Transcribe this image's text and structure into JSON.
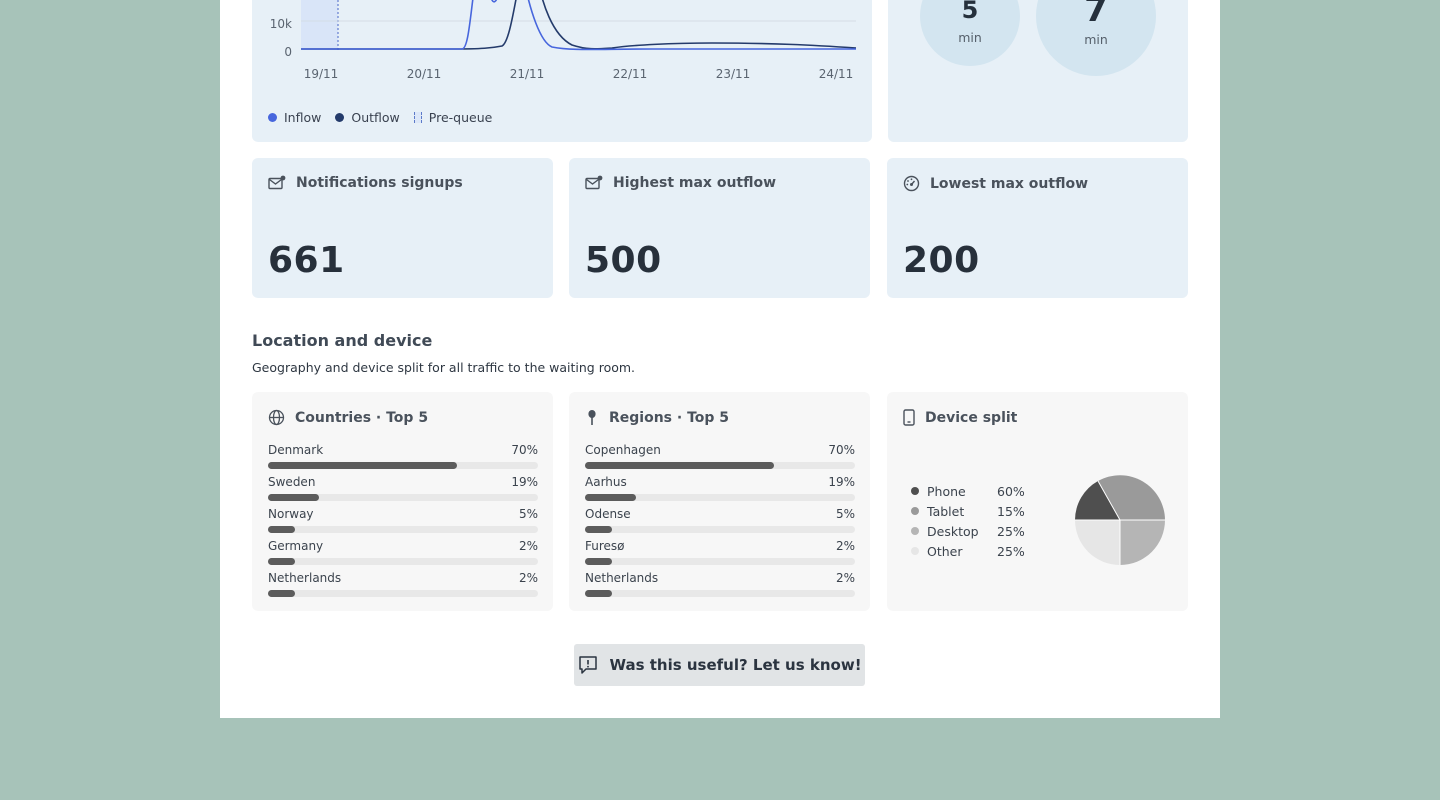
{
  "flow_chart": {
    "y_ticks": [
      "10k",
      "0"
    ],
    "x_ticks": [
      "19/11",
      "20/11",
      "21/11",
      "22/11",
      "23/11",
      "24/11"
    ],
    "legend": {
      "inflow": "Inflow",
      "outflow": "Outflow",
      "prequeue": "Pre-queue"
    },
    "colors": {
      "inflow": "#4766dd",
      "outflow": "#243b6b",
      "prequeue": "#dce7f8"
    }
  },
  "chart_data": {
    "type": "line",
    "x": [
      "19/11",
      "20/11",
      "21/11",
      "22/11",
      "23/11",
      "24/11"
    ],
    "y_ticks": [
      "0",
      "10k"
    ],
    "series": [
      {
        "name": "Inflow",
        "values": [
          0,
          0,
          30000,
          500,
          300,
          0
        ]
      },
      {
        "name": "Outflow",
        "values": [
          0,
          0,
          16000,
          1200,
          2500,
          500
        ]
      }
    ]
  },
  "wait_times": [
    {
      "value": "5",
      "unit": "min"
    },
    {
      "value": "7",
      "unit": "min"
    }
  ],
  "stats": [
    {
      "label": "Notifications signups",
      "value": "661",
      "icon": "mail-notification-icon"
    },
    {
      "label": "Highest max outflow",
      "value": "500",
      "icon": "mail-notification-icon"
    },
    {
      "label": "Lowest max outflow",
      "value": "200",
      "icon": "gauge-icon"
    }
  ],
  "location": {
    "title": "Location and device",
    "subtitle": "Geography and device split for all traffic to the waiting room."
  },
  "countries": {
    "title": "Countries · Top 5",
    "icon": "globe-icon",
    "items": [
      {
        "label": "Denmark",
        "pct": "70%",
        "value": 70
      },
      {
        "label": "Sweden",
        "pct": "19%",
        "value": 19
      },
      {
        "label": "Norway",
        "pct": "5%",
        "value": 5
      },
      {
        "label": "Germany",
        "pct": "2%",
        "value": 2
      },
      {
        "label": "Netherlands",
        "pct": "2%",
        "value": 2
      }
    ]
  },
  "regions": {
    "title": "Regions · Top 5",
    "icon": "map-pin-icon",
    "items": [
      {
        "label": "Copenhagen",
        "pct": "70%",
        "value": 70
      },
      {
        "label": "Aarhus",
        "pct": "19%",
        "value": 19
      },
      {
        "label": "Odense",
        "pct": "5%",
        "value": 5
      },
      {
        "label": "Furesø",
        "pct": "2%",
        "value": 2
      },
      {
        "label": "Netherlands",
        "pct": "2%",
        "value": 2
      }
    ]
  },
  "devices": {
    "title": "Device split",
    "icon": "phone-icon",
    "items": [
      {
        "label": "Phone",
        "pct": "60%",
        "color": "#4f4f4f"
      },
      {
        "label": "Tablet",
        "pct": "15%",
        "color": "#9a9a9a"
      },
      {
        "label": "Desktop",
        "pct": "25%",
        "color": "#b5b5b5"
      },
      {
        "label": "Other",
        "pct": "25%",
        "color": "#e6e6e6"
      }
    ]
  },
  "feedback": {
    "label": "Was this useful? Let us know!"
  }
}
